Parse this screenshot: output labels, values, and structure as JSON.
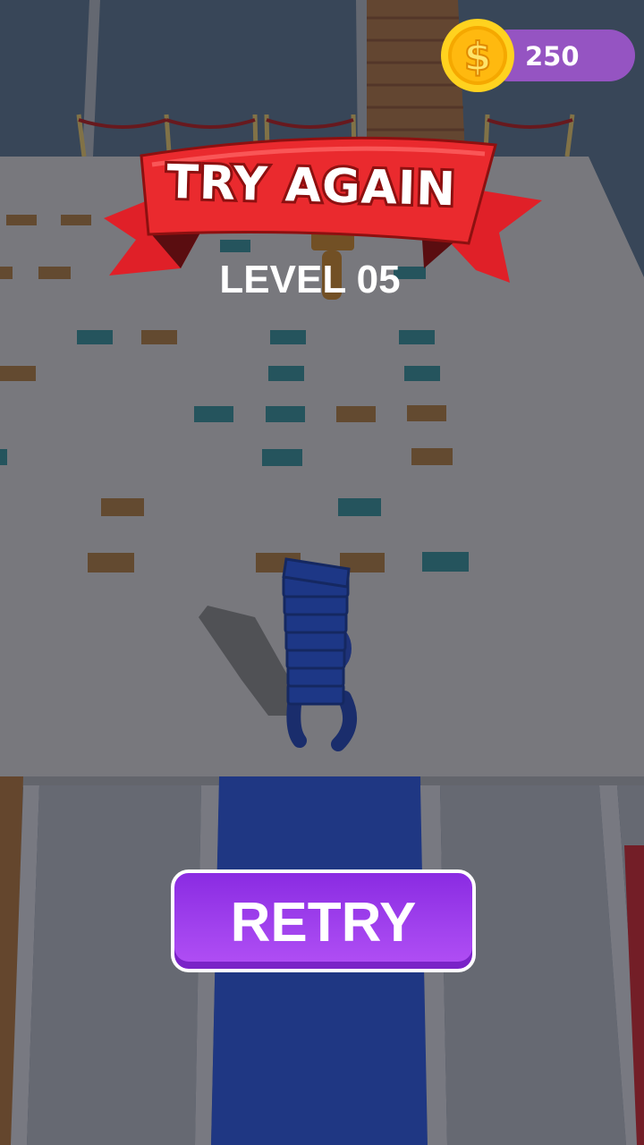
{
  "hud": {
    "coins": "250",
    "coin_icon": "dollar-coin-icon"
  },
  "result": {
    "title": "TRY AGAIN",
    "level": "LEVEL 05"
  },
  "actions": {
    "retry_label": "RETRY"
  },
  "colors": {
    "banner_red": "#e8242a",
    "button_purple": "#9b3cf0",
    "coin_gold": "#f8b400",
    "coin_pill": "#9554c2",
    "player_blue": "#1e3a8f",
    "tile_orange": "#8c5a22",
    "tile_teal": "#236f77"
  }
}
